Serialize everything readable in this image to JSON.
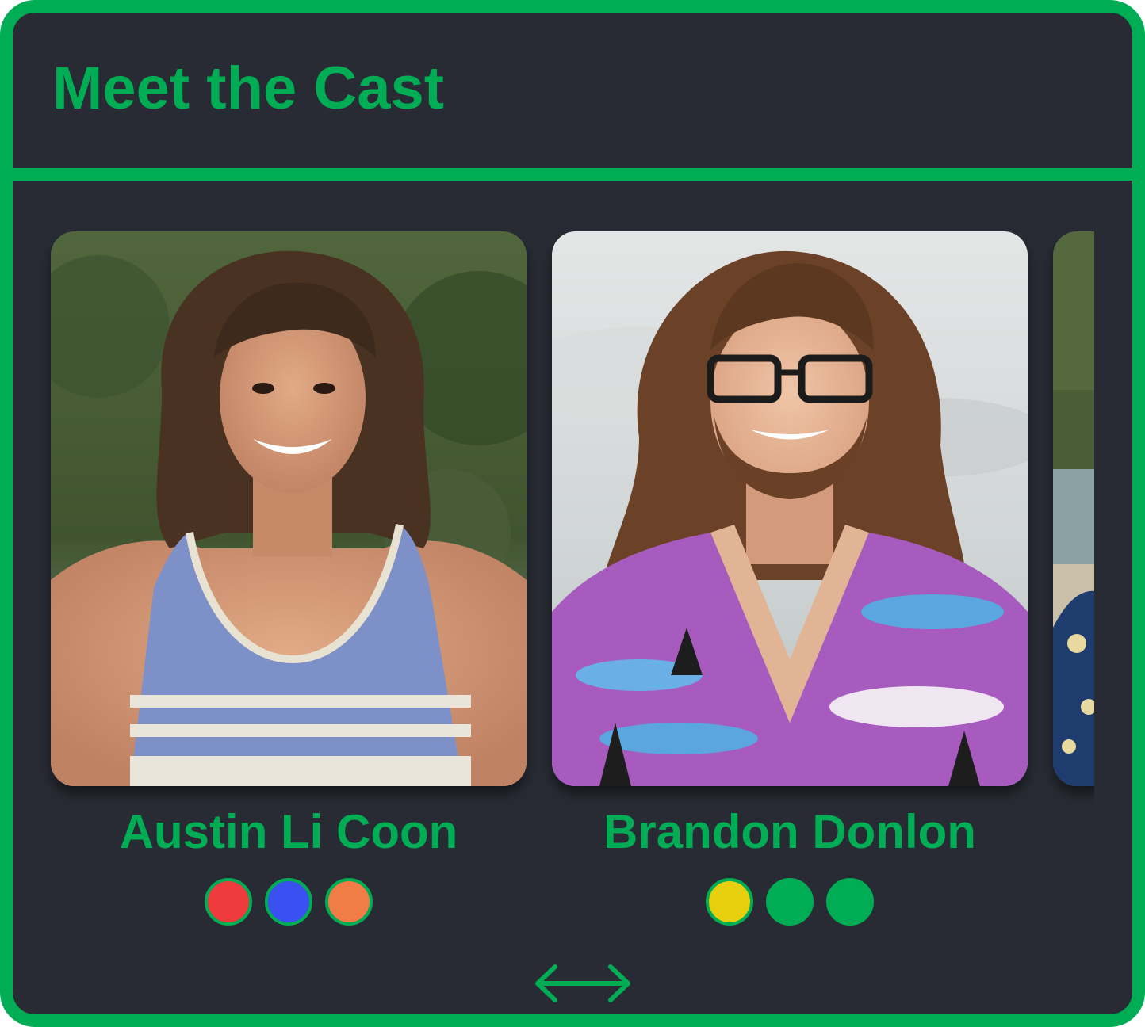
{
  "header": {
    "title": "Meet the Cast"
  },
  "cast": [
    {
      "name": "Austin Li Coon",
      "photo_alt": "Austin Li Coon portrait",
      "tribe_colors": [
        "#ef3b3b",
        "#3b50f0",
        "#ef7d45"
      ]
    },
    {
      "name": "Brandon Donlon",
      "photo_alt": "Brandon Donlon portrait",
      "tribe_colors": [
        "#e5cf0e",
        "#00ad55",
        "#00ad55"
      ]
    },
    {
      "name": "",
      "photo_alt": "Partially visible cast member portrait",
      "tribe_colors": []
    }
  ],
  "colors": {
    "accent": "#00ad55",
    "background": "#282b33"
  },
  "icons": {
    "scroll": "horizontal-scroll-arrows-icon"
  }
}
